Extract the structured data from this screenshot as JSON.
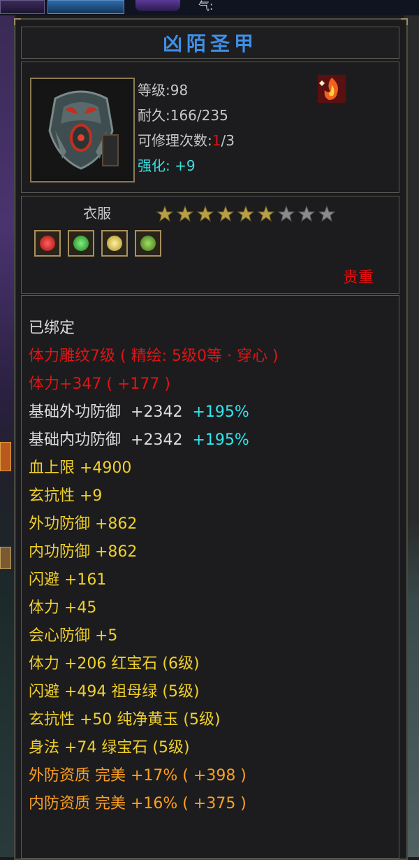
{
  "background": {
    "top_label": "气:"
  },
  "item": {
    "name": "凶陌圣甲",
    "level": "等级:98",
    "durability": "耐久:166/235",
    "repair_prefix": "可修理次数:",
    "repair_used": "1",
    "repair_total": "/3",
    "enhance": "强化: +9",
    "slot": "衣服",
    "stars_filled": 6,
    "stars_total": 9,
    "rarity": "贵重",
    "gems": [
      "red-gem-icon",
      "green-gem-icon",
      "yellow-gem-icon",
      "green-jade-icon"
    ],
    "bound": "已绑定",
    "carve": "体力雕纹7级 ( 精绘: 5级0等 · 穿心 )",
    "stamina_main": "体力+347 ( +177 )",
    "base_outer": {
      "label": "基础外功防御",
      "value": "+2342",
      "pct": "+195%"
    },
    "base_inner": {
      "label": "基础内功防御",
      "value": "+2342",
      "pct": "+195%"
    },
    "attrs": [
      "血上限  +4900",
      "玄抗性  +9",
      "外功防御  +862",
      "内功防御  +862",
      "闪避  +161",
      "体力  +45",
      "会心防御  +5",
      "体力  +206  红宝石 (6级)",
      "闪避  +494  祖母绿 (5级)",
      "玄抗性  +50  纯净黄玉 (5级)",
      "身法  +74  绿宝石 (5级)"
    ],
    "quality": [
      "外防资质    完美  +17% ( +398 )",
      "内防资质    完美  +16% ( +375 )"
    ]
  },
  "colors": {
    "title": "#3f8ee6",
    "enhance": "#38e0e0",
    "rarity": "#e01010",
    "attribute": "#f0d02a",
    "quality": "#ffa020"
  }
}
